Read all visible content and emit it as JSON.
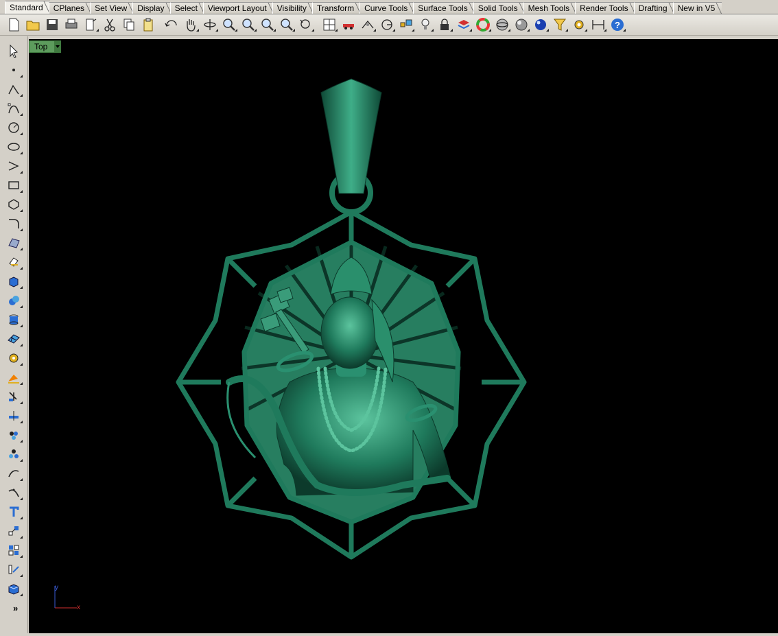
{
  "tabs": [
    {
      "label": "Standard",
      "active": true
    },
    {
      "label": "CPlanes"
    },
    {
      "label": "Set View"
    },
    {
      "label": "Display"
    },
    {
      "label": "Select"
    },
    {
      "label": "Viewport Layout"
    },
    {
      "label": "Visibility"
    },
    {
      "label": "Transform"
    },
    {
      "label": "Curve Tools"
    },
    {
      "label": "Surface Tools"
    },
    {
      "label": "Solid Tools"
    },
    {
      "label": "Mesh Tools"
    },
    {
      "label": "Render Tools"
    },
    {
      "label": "Drafting"
    },
    {
      "label": "New in V5"
    }
  ],
  "toolbar_icons": [
    "new-file-icon",
    "open-folder-icon",
    "save-icon",
    "print-icon",
    "import-icon",
    "cut-icon",
    "copy-icon",
    "paste-icon",
    "undo-icon",
    "pan-hand-icon",
    "rotate-view-icon",
    "zoom-icon",
    "zoom-window-icon",
    "zoom-extents-icon",
    "zoom-selected-icon",
    "undo-view-icon",
    "four-viewports-icon",
    "car-icon",
    "grid-snap-icon",
    "osnap-icon",
    "properties-icon",
    "light-icon",
    "lock-icon",
    "layer-icon",
    "color-wheel-icon",
    "wireframe-sphere-icon",
    "shaded-sphere-icon",
    "rendered-sphere-icon",
    "select-filter-icon",
    "options-gear-icon",
    "dimension-icon",
    "help-icon"
  ],
  "sidebar_icons": [
    "select-arrow-icon",
    "point-icon",
    "polyline-icon",
    "curve-icon",
    "circle-icon",
    "ellipse-icon",
    "arc-icon",
    "rectangle-icon",
    "polygon-icon",
    "fillet-curve-icon",
    "surface-icon",
    "extrude-icon",
    "box-icon",
    "boolean-icon",
    "cylinder-icon",
    "mesh-icon",
    "solid-edit-icon",
    "explode-icon",
    "trim-icon",
    "split-icon",
    "group-icon",
    "array-icon",
    "rebuild-icon",
    "edit-point-icon",
    "text-icon",
    "scale-icon",
    "arrange-icon",
    "dimension-side-icon",
    "render-side-icon"
  ],
  "viewport": {
    "title": "Top",
    "axis_y_label": "y",
    "axis_x_label": "x",
    "model_color": "#1f7a5c"
  },
  "sidebar_more": "»"
}
